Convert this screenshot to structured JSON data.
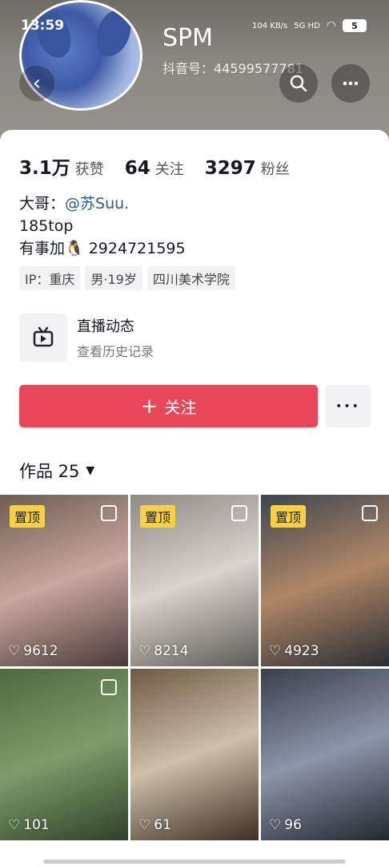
{
  "status_bar": {
    "time": "13:59",
    "net_speed": "104 KB/s",
    "network": "5G HD",
    "battery": "5"
  },
  "profile": {
    "nickname": "SPM",
    "douyin_id": "抖音号：44599577781",
    "stats": [
      {
        "value": "3.1万",
        "label": "获赞"
      },
      {
        "value": "64",
        "label": "关注"
      },
      {
        "value": "3297",
        "label": "粉丝"
      }
    ],
    "bio_line1_prefix": "大哥：",
    "bio_line1_mention": "@苏Suu.",
    "bio_line2": "185top",
    "bio_line3": "有事加🐧 2924721595",
    "tags": [
      "IP：重庆",
      "男·19岁",
      "四川美术学院"
    ]
  },
  "live": {
    "title": "直播动态",
    "subtitle": "查看历史记录"
  },
  "actions": {
    "follow_label": "关注",
    "more_label": "•••"
  },
  "works": {
    "title": "作品 25",
    "items": [
      {
        "pinned": true,
        "pin_label": "置顶",
        "likes": "9612",
        "colors": [
          "#6d5d4f",
          "#c9a6a0",
          "#4a3a36"
        ]
      },
      {
        "pinned": true,
        "pin_label": "置顶",
        "likes": "8214",
        "colors": [
          "#8f8b84",
          "#d8d4cc",
          "#5e5a55"
        ]
      },
      {
        "pinned": true,
        "pin_label": "置顶",
        "likes": "4923",
        "colors": [
          "#3f4650",
          "#b08666",
          "#2a2e35"
        ]
      },
      {
        "pinned": false,
        "pin_label": "",
        "likes": "101",
        "colors": [
          "#4d6a3e",
          "#7e9c6a",
          "#2f4128"
        ]
      },
      {
        "pinned": false,
        "pin_label": "",
        "likes": "61",
        "colors": [
          "#6e5a44",
          "#cdbfa8",
          "#3c2f24"
        ]
      },
      {
        "pinned": false,
        "pin_label": "",
        "likes": "96",
        "colors": [
          "#3a3f4a",
          "#8c96a8",
          "#23262d"
        ]
      }
    ]
  }
}
